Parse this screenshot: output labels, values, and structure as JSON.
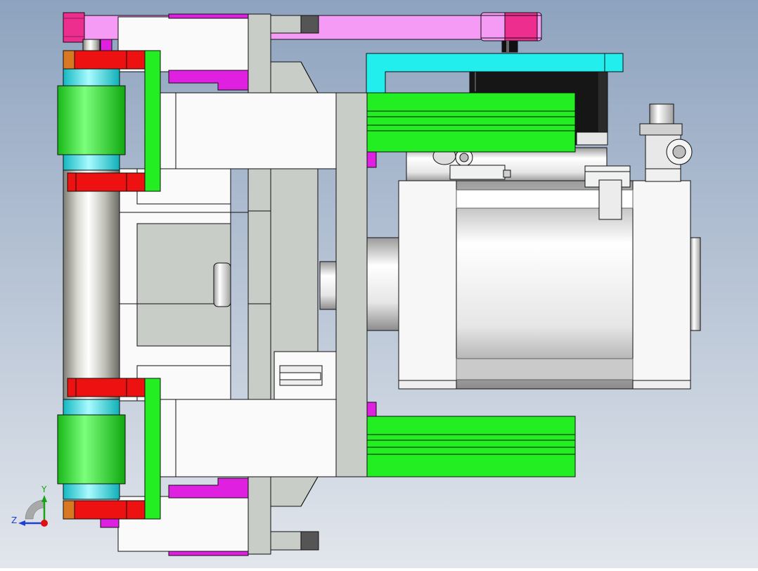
{
  "viewport": {
    "background_top": "#8ea3bf",
    "background_bottom": "#e2e6ec"
  },
  "triad": {
    "y_label": "Y",
    "z_label": "Z",
    "y_color": "#16a316",
    "z_color": "#2040d0",
    "x_color": "#e01010"
  },
  "part_colors": {
    "belt": "#f59af5",
    "pulley": "#ee2e8e",
    "bracket_magenta": "#e020e0",
    "collar_red": "#ee1111",
    "roller_green": "#22ee22",
    "sleeve_cyan": "#22e6ee",
    "cyan_arm": "#22eeee",
    "frame_white": "#fafafa",
    "plate_gray": "#c8cdc8",
    "motor_black": "#161616",
    "metal_light": "#f0f2f2",
    "metal_dark": "#8a8a8a",
    "outline": "#101010"
  }
}
